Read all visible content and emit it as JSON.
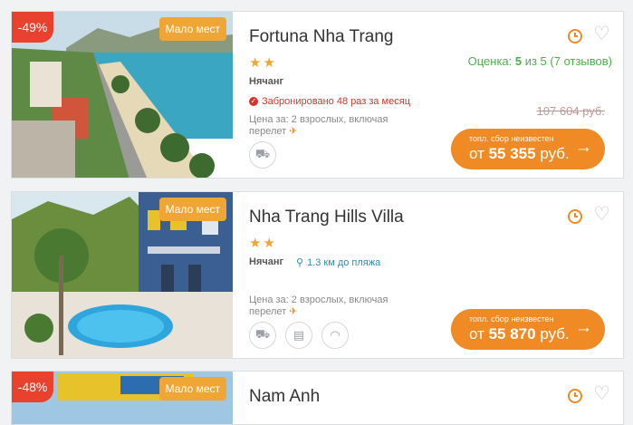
{
  "hotels": [
    {
      "discount": "-49%",
      "few_places": "Мало мест",
      "name": "Fortuna Nha Trang",
      "stars": "★★",
      "city": "Нячанг",
      "booked": "Забронировано 48 раз за месяц",
      "price_for": "Цена за: 2 взрослых, включая перелет",
      "rating_prefix": "Оценка: ",
      "rating_value": "5",
      "rating_suffix": " из 5 (7 отзывов)",
      "old_price": "107 604 руб.",
      "fee_note": "топл. сбор неизвестен",
      "price_from": "от ",
      "price": "55 355",
      "currency": " руб."
    },
    {
      "few_places": "Мало мест",
      "name": "Nha Trang Hills Villa",
      "stars": "★★",
      "city": "Нячанг",
      "beach": "1.3 км до пляжа",
      "price_for": "Цена за: 2 взрослых, включая перелет",
      "fee_note": "топл. сбор неизвестен",
      "price_from": "от ",
      "price": "55 870",
      "currency": " руб."
    },
    {
      "discount": "-48%",
      "few_places": "Мало мест",
      "name": "Nam Anh"
    }
  ],
  "icons": [
    "clock-icon",
    "heart-icon",
    "check-icon",
    "plane-icon",
    "pin-icon",
    "transfer-icon",
    "tv-icon",
    "wifi-icon",
    "arrow-right-icon"
  ],
  "colors": {
    "accent": "#f08a24",
    "discount": "#e8412d",
    "few_places": "#f0a635",
    "rating": "#4cae4c",
    "booked": "#d9342b",
    "beach": "#2e8fb0"
  }
}
